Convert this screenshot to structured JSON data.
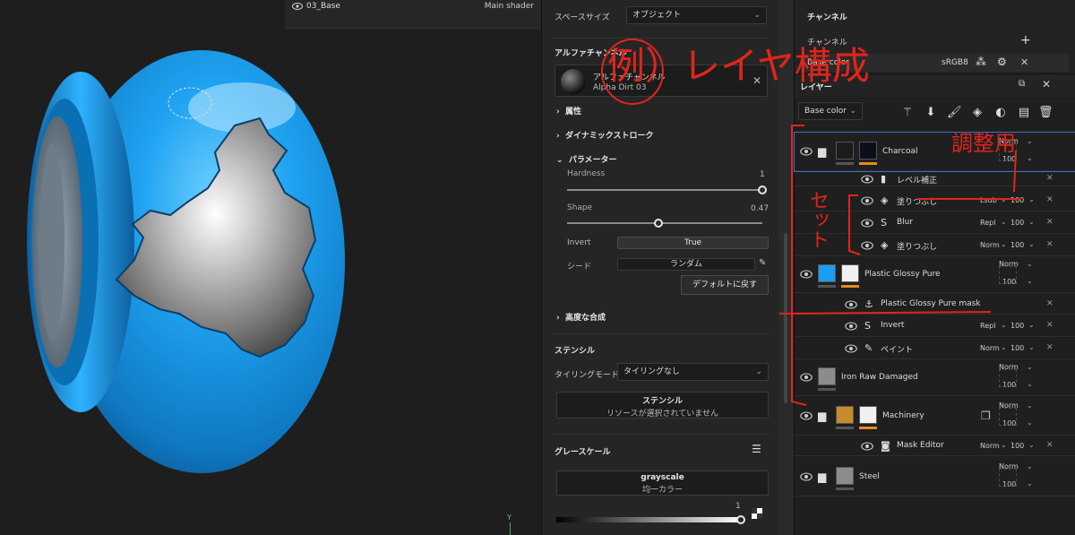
{
  "texture_set": {
    "name": "03_Base",
    "shader": "Main shader"
  },
  "axis_label": "Y",
  "props": {
    "space_size_label": "スペースサイズ",
    "space_size_value": "オブジェクト",
    "alpha_section": "アルファチャンネル",
    "alpha_item_title": "アルファチャンネル",
    "alpha_item_name": "Alpha Dirt 03",
    "attributes": "属性",
    "dynamic_stroke": "ダイナミックストローク",
    "parameters": "パラメーター",
    "hardness_label": "Hardness",
    "hardness_value": "1",
    "hardness_level": 1.0,
    "shape_label": "Shape",
    "shape_value": "0.47",
    "shape_level": 0.47,
    "invert_label": "Invert",
    "invert_value": "True",
    "seed_label": "シード",
    "seed_value": "ランダム",
    "reset_button": "デフォルトに戻す",
    "advanced_blend": "高度な合成",
    "stencil_section": "ステンシル",
    "tiling_label": "タイリングモード",
    "tiling_value": "タイリングなし",
    "stencil_title": "ステンシル",
    "stencil_empty": "リソースが選択されていません",
    "grayscale_section": "グレースケール",
    "grayscale_title": "grayscale",
    "grayscale_sub": "均一カラー",
    "grayscale_value": "1"
  },
  "channels": {
    "title": "チャンネル",
    "channel_label": "チャンネル",
    "base_color": "Base color",
    "format": "sRGB8"
  },
  "layers": {
    "title": "レイヤー",
    "channel_select": "Base color",
    "items": [
      {
        "name": "Charcoal",
        "blend": "Norm",
        "opacity": "100"
      },
      {
        "name": "レベル補正"
      },
      {
        "name": "塗りつぶし",
        "blend": "Lsub",
        "opacity": "100"
      },
      {
        "name": "Blur",
        "blend": "Repl",
        "opacity": "100"
      },
      {
        "name": "塗りつぶし",
        "blend": "Norm",
        "opacity": "100"
      },
      {
        "name": "Plastic Glossy Pure",
        "blend": "Norm",
        "opacity": "100"
      },
      {
        "name": "Plastic Glossy Pure mask"
      },
      {
        "name": "Invert",
        "blend": "Repl",
        "opacity": "100"
      },
      {
        "name": "ペイント",
        "blend": "Norm",
        "opacity": "100"
      },
      {
        "name": "Iron Raw Damaged",
        "blend": "Norm",
        "opacity": "100"
      },
      {
        "name": "Machinery",
        "blend": "Norm",
        "opacity": "100"
      },
      {
        "name": "Mask Editor",
        "blend": "Norm",
        "opacity": "100"
      },
      {
        "name": "Steel",
        "blend": "Norm",
        "opacity": "100"
      }
    ]
  },
  "annotations": {
    "title": "例）レイヤ構成",
    "adjust": "調整用",
    "set": "セット"
  },
  "colors": {
    "sphere": "#1a9ff0",
    "accent_orange": "#e58a1f",
    "annotation_red": "#e0251c",
    "selection": "#3c6ec8"
  }
}
